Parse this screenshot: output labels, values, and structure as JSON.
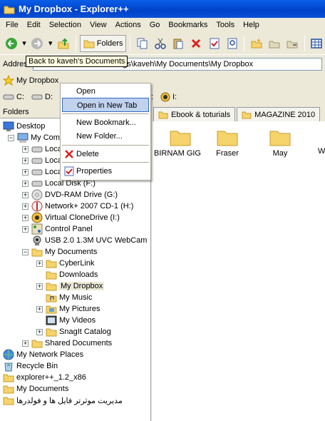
{
  "window": {
    "title": "My Dropbox - Explorer++"
  },
  "menu": [
    "File",
    "Edit",
    "Selection",
    "View",
    "Actions",
    "Go",
    "Bookmarks",
    "Tools",
    "Help"
  ],
  "toolbar": {
    "folders_label": "Folders"
  },
  "tooltip": "Back to kaveh's Documents",
  "address": {
    "label": "Address",
    "path": "C:\\Documents and Settings\\kaveh\\My Documents\\My Dropbox"
  },
  "bookmarks": {
    "item": "My Dropbox"
  },
  "drives": [
    "C:",
    "D:",
    "H:",
    "I:"
  ],
  "leftpane": {
    "header": "Folders"
  },
  "tree": [
    {
      "label": "Desktop",
      "depth": 0,
      "exp": "",
      "icon": "desktop"
    },
    {
      "label": "My Computer",
      "depth": 1,
      "exp": "-",
      "icon": "computer"
    },
    {
      "label": "Local Disk (C:)",
      "depth": 2,
      "exp": "+",
      "icon": "drive"
    },
    {
      "label": "Local Disk (D:)",
      "depth": 2,
      "exp": "+",
      "icon": "drive"
    },
    {
      "label": "Local Disk (E:)",
      "depth": 2,
      "exp": "+",
      "icon": "drive"
    },
    {
      "label": "Local Disk (F:)",
      "depth": 2,
      "exp": "+",
      "icon": "drive"
    },
    {
      "label": "DVD-RAM Drive (G:)",
      "depth": 2,
      "exp": "+",
      "icon": "cd"
    },
    {
      "label": "Network+ 2007 CD-1 (H:)",
      "depth": 2,
      "exp": "+",
      "icon": "cdred"
    },
    {
      "label": "Virtual CloneDrive (I:)",
      "depth": 2,
      "exp": "+",
      "icon": "sheep"
    },
    {
      "label": "Control Panel",
      "depth": 2,
      "exp": "+",
      "icon": "cpanel"
    },
    {
      "label": "USB 2.0 1.3M UVC WebCam",
      "depth": 2,
      "exp": "",
      "icon": "cam"
    },
    {
      "label": "My Documents",
      "depth": 2,
      "exp": "-",
      "icon": "folder"
    },
    {
      "label": "CyberLink",
      "depth": 3,
      "exp": "+",
      "icon": "folder"
    },
    {
      "label": "Downloads",
      "depth": 3,
      "exp": "",
      "icon": "folder"
    },
    {
      "label": "My Dropbox",
      "depth": 3,
      "exp": "+",
      "icon": "folder",
      "selected": true
    },
    {
      "label": "My Music",
      "depth": 3,
      "exp": "",
      "icon": "music"
    },
    {
      "label": "My Pictures",
      "depth": 3,
      "exp": "+",
      "icon": "pictures"
    },
    {
      "label": "My Videos",
      "depth": 3,
      "exp": "",
      "icon": "videos"
    },
    {
      "label": "SnagIt Catalog",
      "depth": 3,
      "exp": "+",
      "icon": "folder"
    },
    {
      "label": "Shared Documents",
      "depth": 2,
      "exp": "+",
      "icon": "folder"
    },
    {
      "label": "My Network Places",
      "depth": 0,
      "exp": "+",
      "icon": "network"
    },
    {
      "label": "Recycle Bin",
      "depth": 0,
      "exp": "",
      "icon": "recycle"
    },
    {
      "label": "explorer++_1.2_x86",
      "depth": 0,
      "exp": "",
      "icon": "folder"
    },
    {
      "label": "My Documents",
      "depth": 0,
      "exp": "+",
      "icon": "folder"
    },
    {
      "label": "مدیریت موثرتر فایل ها و فولدرها",
      "depth": 0,
      "exp": "+",
      "icon": "folder"
    }
  ],
  "tabs": [
    "Ebook & toturials",
    "MAGAZINE 2010"
  ],
  "items": [
    "BIRNAM GIG",
    "Fraser",
    "May",
    "W"
  ],
  "context_menu": {
    "open": "Open",
    "open_new_tab": "Open in New Tab",
    "new_bookmark": "New Bookmark...",
    "new_folder": "New Folder...",
    "delete": "Delete",
    "properties": "Properties"
  },
  "colors": {
    "title_bar": "#0042c8",
    "selection": "#c1d2ee",
    "folder": "#f6d36b"
  }
}
